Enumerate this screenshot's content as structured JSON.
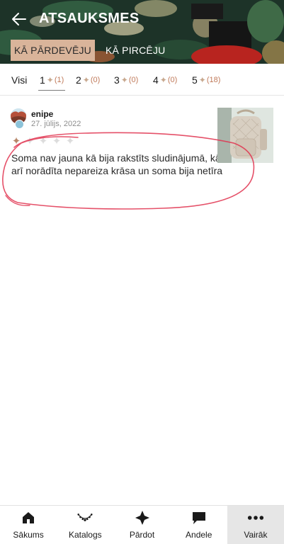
{
  "header": {
    "title": "ATSAUKSMES",
    "back_icon": "arrow-left-icon",
    "roles": [
      {
        "label": "KĀ PĀRDEVĒJU",
        "active": true
      },
      {
        "label": "KĀ PIRCĒJU",
        "active": false
      }
    ]
  },
  "filters": [
    {
      "label": "Visi",
      "count": "",
      "active": false
    },
    {
      "label": "1",
      "count": "(1)",
      "active": true
    },
    {
      "label": "2",
      "count": "(0)",
      "active": false
    },
    {
      "label": "3",
      "count": "(0)",
      "active": false
    },
    {
      "label": "4",
      "count": "(0)",
      "active": false
    },
    {
      "label": "5",
      "count": "(18)",
      "active": false
    }
  ],
  "review": {
    "username": "enipe",
    "date": "27. jūlijs, 2022",
    "rating": 1,
    "max_rating": 5,
    "text": "Soma nav jauna kā bija rakstīts sludinājumā, kā arī norādīta nepareiza krāsa un soma bija netīra"
  },
  "bottom_nav": [
    {
      "label": "Sākums",
      "icon": "home-icon",
      "selected": false
    },
    {
      "label": "Katalogs",
      "icon": "necklace-icon",
      "selected": false
    },
    {
      "label": "Pārdot",
      "icon": "sell-star-icon",
      "selected": false
    },
    {
      "label": "Andele",
      "icon": "chat-bubble-icon",
      "selected": false
    },
    {
      "label": "Vairāk",
      "icon": "more-dots-icon",
      "selected": true
    }
  ],
  "colors": {
    "accent": "#d9b49a",
    "star_on": "#b7876a",
    "star_off": "#dcdcdc",
    "count": "#c07a5a",
    "annotation": "#e0324f"
  }
}
